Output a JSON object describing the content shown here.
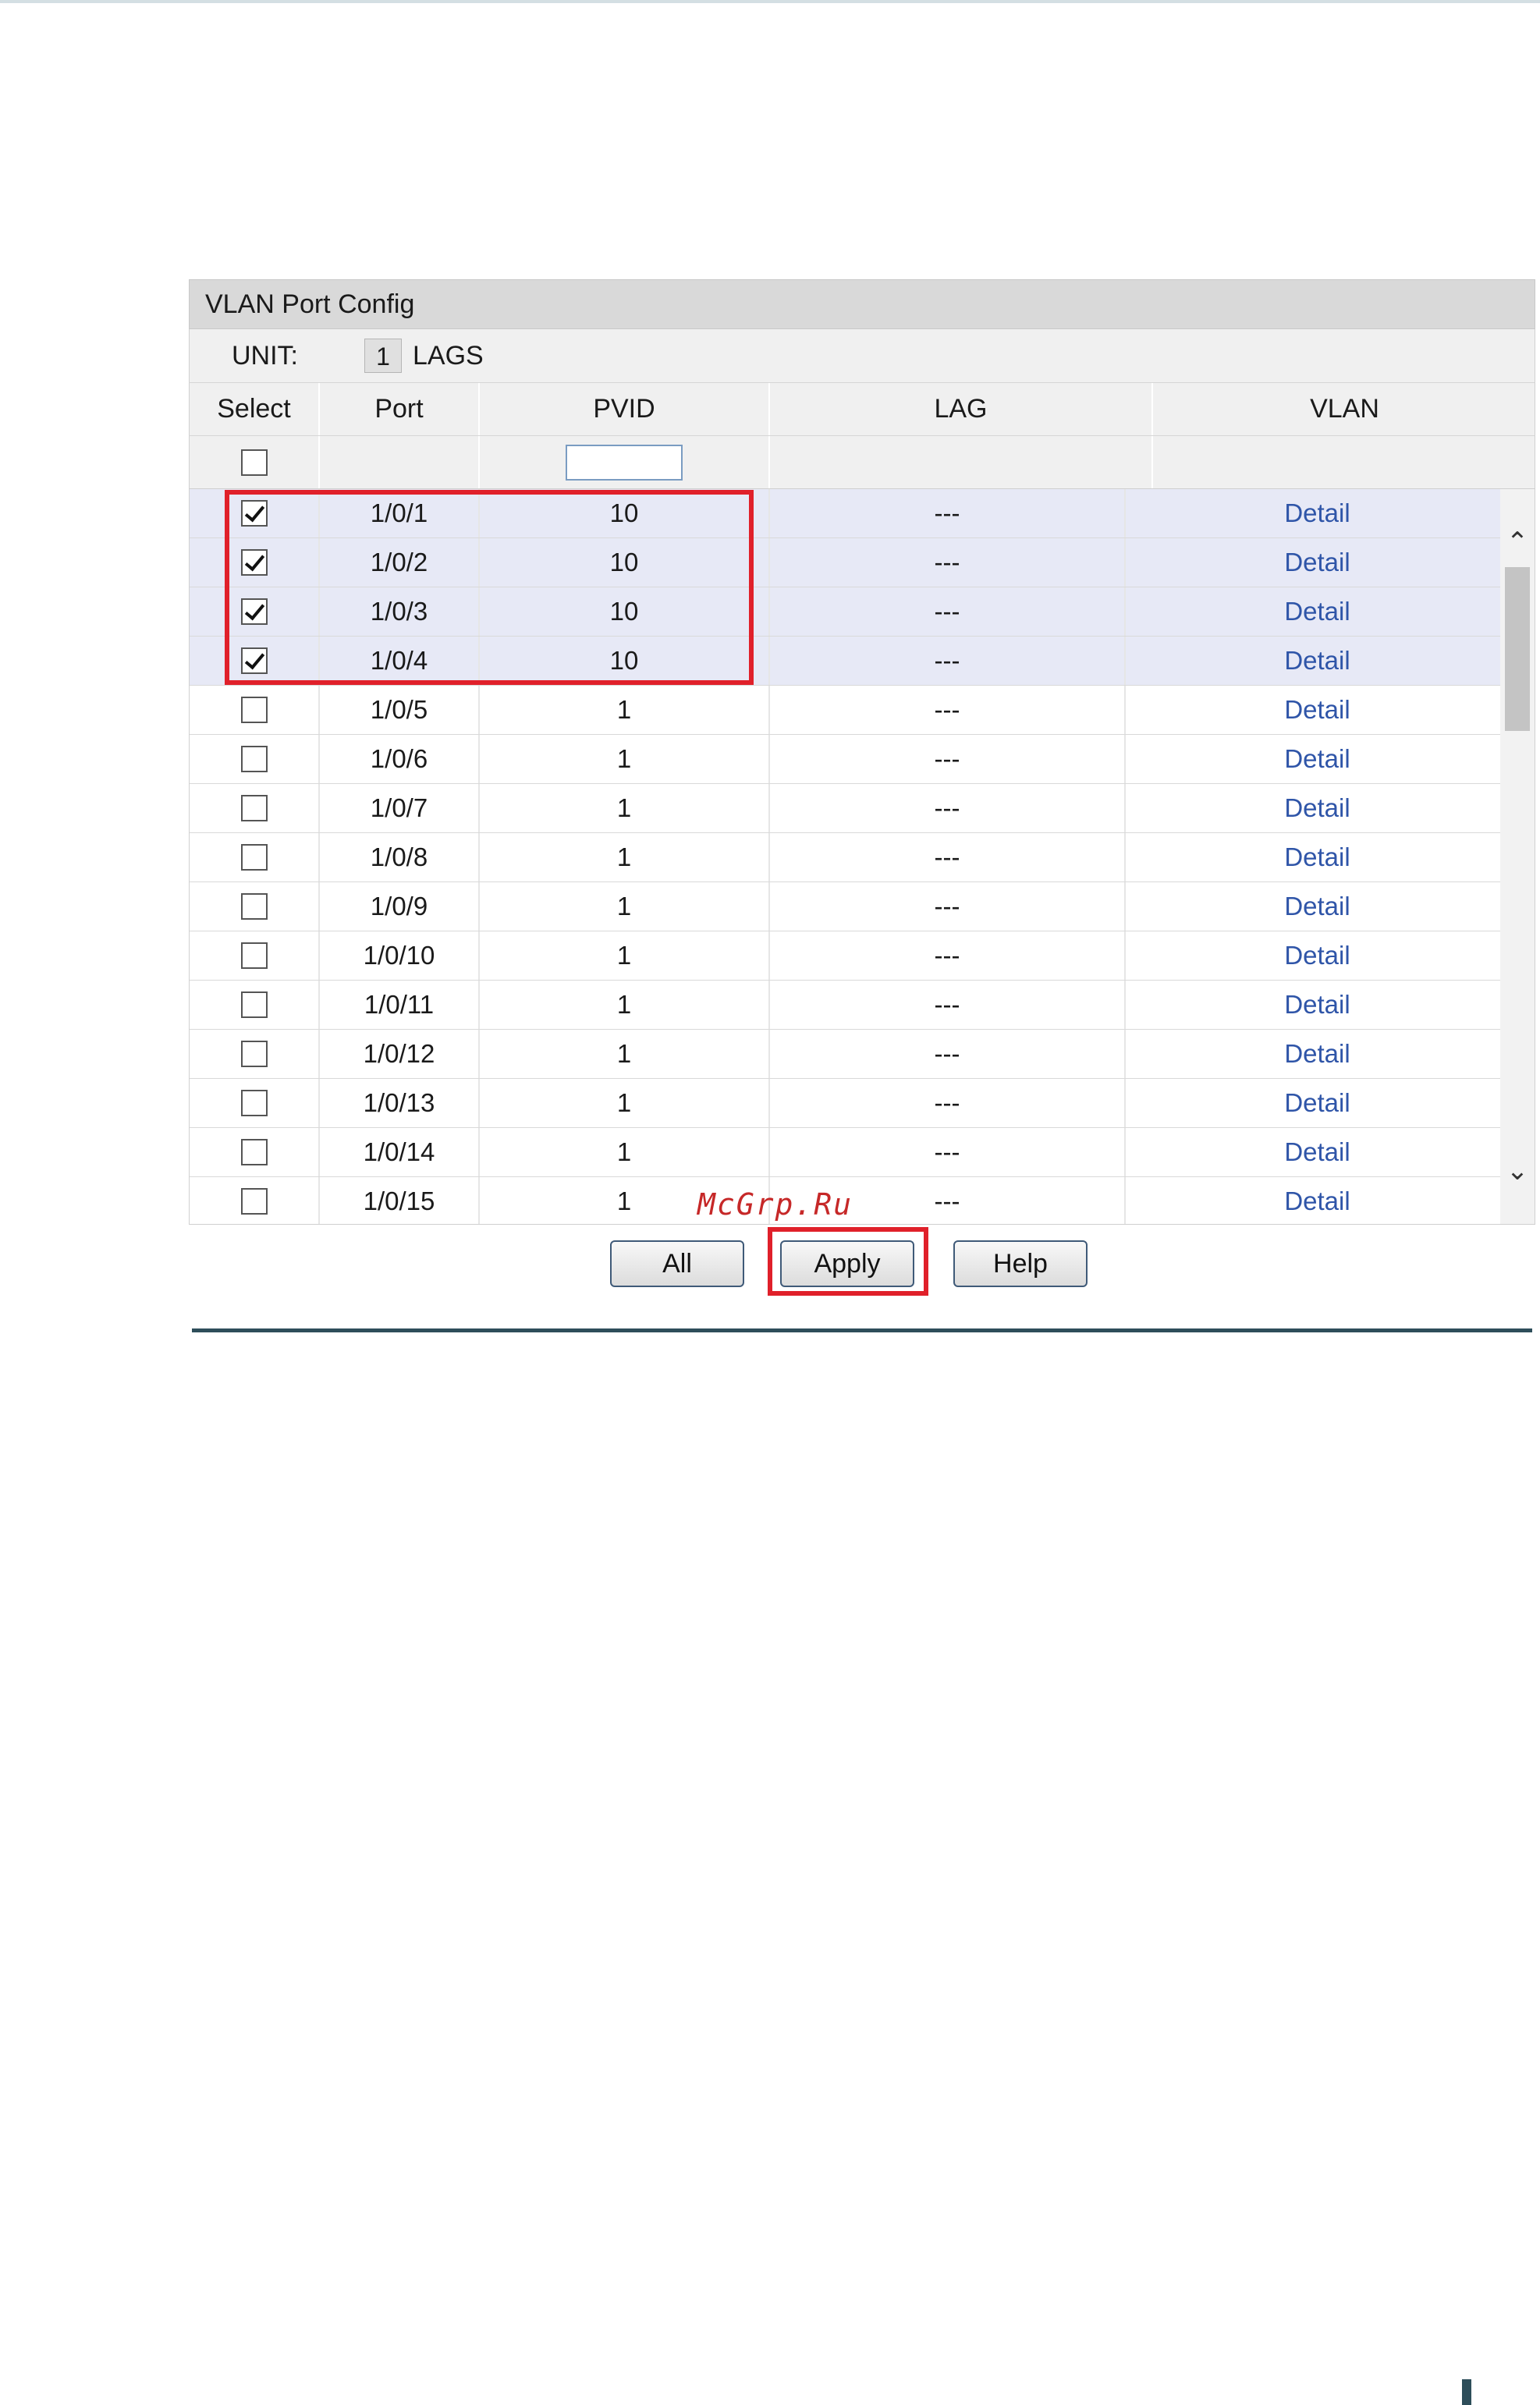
{
  "panel": {
    "title": "VLAN Port Config",
    "unit_label": "UNIT:",
    "unit_value": "1",
    "lags_label": "LAGS"
  },
  "columns": {
    "select": "Select",
    "port": "Port",
    "pvid": "PVID",
    "lag": "LAG",
    "vlan": "VLAN"
  },
  "filter": {
    "pvid_value": ""
  },
  "rows": [
    {
      "selected": true,
      "port": "1/0/1",
      "pvid": "10",
      "lag": "---",
      "vlan": "Detail"
    },
    {
      "selected": true,
      "port": "1/0/2",
      "pvid": "10",
      "lag": "---",
      "vlan": "Detail"
    },
    {
      "selected": true,
      "port": "1/0/3",
      "pvid": "10",
      "lag": "---",
      "vlan": "Detail"
    },
    {
      "selected": true,
      "port": "1/0/4",
      "pvid": "10",
      "lag": "---",
      "vlan": "Detail"
    },
    {
      "selected": false,
      "port": "1/0/5",
      "pvid": "1",
      "lag": "---",
      "vlan": "Detail"
    },
    {
      "selected": false,
      "port": "1/0/6",
      "pvid": "1",
      "lag": "---",
      "vlan": "Detail"
    },
    {
      "selected": false,
      "port": "1/0/7",
      "pvid": "1",
      "lag": "---",
      "vlan": "Detail"
    },
    {
      "selected": false,
      "port": "1/0/8",
      "pvid": "1",
      "lag": "---",
      "vlan": "Detail"
    },
    {
      "selected": false,
      "port": "1/0/9",
      "pvid": "1",
      "lag": "---",
      "vlan": "Detail"
    },
    {
      "selected": false,
      "port": "1/0/10",
      "pvid": "1",
      "lag": "---",
      "vlan": "Detail"
    },
    {
      "selected": false,
      "port": "1/0/11",
      "pvid": "1",
      "lag": "---",
      "vlan": "Detail"
    },
    {
      "selected": false,
      "port": "1/0/12",
      "pvid": "1",
      "lag": "---",
      "vlan": "Detail"
    },
    {
      "selected": false,
      "port": "1/0/13",
      "pvid": "1",
      "lag": "---",
      "vlan": "Detail"
    },
    {
      "selected": false,
      "port": "1/0/14",
      "pvid": "1",
      "lag": "---",
      "vlan": "Detail"
    },
    {
      "selected": false,
      "port": "1/0/15",
      "pvid": "1",
      "lag": "---",
      "vlan": "Detail"
    }
  ],
  "buttons": {
    "all": "All",
    "apply": "Apply",
    "help": "Help"
  },
  "watermark": "McGrp.Ru",
  "colors": {
    "highlight": "#e0202a",
    "selected_row": "#e7e9f6",
    "link": "#2f55a8",
    "header": "#d9d9d9"
  }
}
